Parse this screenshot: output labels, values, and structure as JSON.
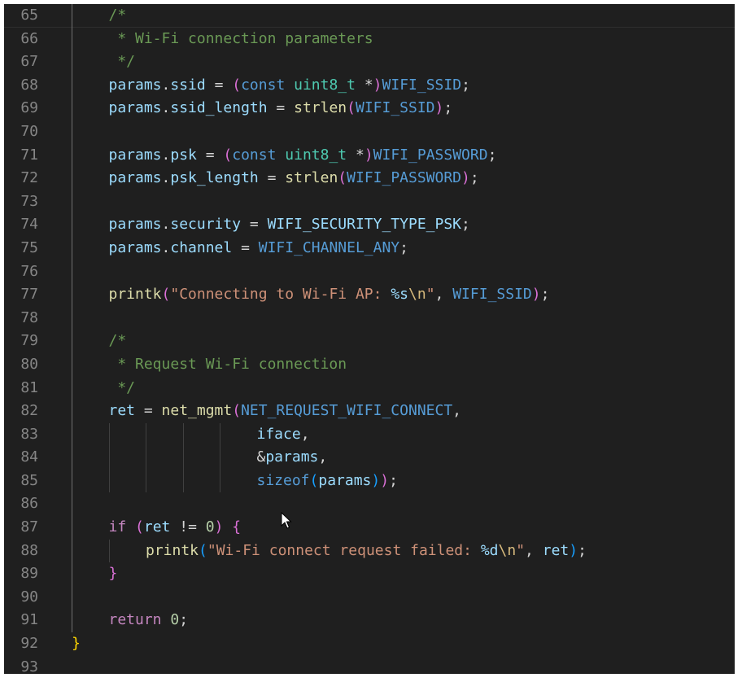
{
  "editor": {
    "lines": [
      {
        "n": "65",
        "indent": 1,
        "tokens": [
          {
            "t": "/*",
            "c": "cmt"
          }
        ]
      },
      {
        "n": "66",
        "indent": 1,
        "tokens": [
          {
            "t": " * Wi-Fi connection parameters",
            "c": "cmt"
          }
        ]
      },
      {
        "n": "67",
        "indent": 1,
        "tokens": [
          {
            "t": " */",
            "c": "cmt"
          }
        ]
      },
      {
        "n": "68",
        "indent": 1,
        "tokens": [
          {
            "t": "params",
            "c": "var"
          },
          {
            "t": ".",
            "c": "pun"
          },
          {
            "t": "ssid",
            "c": "var"
          },
          {
            "t": " = ",
            "c": "pun"
          },
          {
            "t": "(",
            "c": "br2"
          },
          {
            "t": "const",
            "c": "kw"
          },
          {
            "t": " ",
            "c": "pun"
          },
          {
            "t": "uint8_t",
            "c": "typ"
          },
          {
            "t": " *",
            "c": "pun"
          },
          {
            "t": ")",
            "c": "br2"
          },
          {
            "t": "WIFI_SSID",
            "c": "mac"
          },
          {
            "t": ";",
            "c": "pun"
          }
        ]
      },
      {
        "n": "69",
        "indent": 1,
        "tokens": [
          {
            "t": "params",
            "c": "var"
          },
          {
            "t": ".",
            "c": "pun"
          },
          {
            "t": "ssid_length",
            "c": "var"
          },
          {
            "t": " = ",
            "c": "pun"
          },
          {
            "t": "strlen",
            "c": "fn"
          },
          {
            "t": "(",
            "c": "br2"
          },
          {
            "t": "WIFI_SSID",
            "c": "mac"
          },
          {
            "t": ")",
            "c": "br2"
          },
          {
            "t": ";",
            "c": "pun"
          }
        ]
      },
      {
        "n": "70",
        "indent": 1,
        "tokens": []
      },
      {
        "n": "71",
        "indent": 1,
        "tokens": [
          {
            "t": "params",
            "c": "var"
          },
          {
            "t": ".",
            "c": "pun"
          },
          {
            "t": "psk",
            "c": "var"
          },
          {
            "t": " = ",
            "c": "pun"
          },
          {
            "t": "(",
            "c": "br2"
          },
          {
            "t": "const",
            "c": "kw"
          },
          {
            "t": " ",
            "c": "pun"
          },
          {
            "t": "uint8_t",
            "c": "typ"
          },
          {
            "t": " *",
            "c": "pun"
          },
          {
            "t": ")",
            "c": "br2"
          },
          {
            "t": "WIFI_PASSWORD",
            "c": "mac"
          },
          {
            "t": ";",
            "c": "pun"
          }
        ]
      },
      {
        "n": "72",
        "indent": 1,
        "tokens": [
          {
            "t": "params",
            "c": "var"
          },
          {
            "t": ".",
            "c": "pun"
          },
          {
            "t": "psk_length",
            "c": "var"
          },
          {
            "t": " = ",
            "c": "pun"
          },
          {
            "t": "strlen",
            "c": "fn"
          },
          {
            "t": "(",
            "c": "br2"
          },
          {
            "t": "WIFI_PASSWORD",
            "c": "mac"
          },
          {
            "t": ")",
            "c": "br2"
          },
          {
            "t": ";",
            "c": "pun"
          }
        ]
      },
      {
        "n": "73",
        "indent": 1,
        "tokens": []
      },
      {
        "n": "74",
        "indent": 1,
        "tokens": [
          {
            "t": "params",
            "c": "var"
          },
          {
            "t": ".",
            "c": "pun"
          },
          {
            "t": "security",
            "c": "var"
          },
          {
            "t": " = ",
            "c": "pun"
          },
          {
            "t": "WIFI_SECURITY_TYPE_PSK",
            "c": "var"
          },
          {
            "t": ";",
            "c": "pun"
          }
        ]
      },
      {
        "n": "75",
        "indent": 1,
        "tokens": [
          {
            "t": "params",
            "c": "var"
          },
          {
            "t": ".",
            "c": "pun"
          },
          {
            "t": "channel",
            "c": "var"
          },
          {
            "t": " = ",
            "c": "pun"
          },
          {
            "t": "WIFI_CHANNEL_ANY",
            "c": "mac"
          },
          {
            "t": ";",
            "c": "pun"
          }
        ]
      },
      {
        "n": "76",
        "indent": 1,
        "tokens": []
      },
      {
        "n": "77",
        "indent": 1,
        "tokens": [
          {
            "t": "printk",
            "c": "fn"
          },
          {
            "t": "(",
            "c": "br2"
          },
          {
            "t": "\"Connecting to Wi-Fi AP: ",
            "c": "str"
          },
          {
            "t": "%s",
            "c": "fmt"
          },
          {
            "t": "\\n",
            "c": "esc"
          },
          {
            "t": "\"",
            "c": "str"
          },
          {
            "t": ", ",
            "c": "pun"
          },
          {
            "t": "WIFI_SSID",
            "c": "mac"
          },
          {
            "t": ")",
            "c": "br2"
          },
          {
            "t": ";",
            "c": "pun"
          }
        ]
      },
      {
        "n": "78",
        "indent": 1,
        "tokens": []
      },
      {
        "n": "79",
        "indent": 1,
        "tokens": [
          {
            "t": "/*",
            "c": "cmt"
          }
        ]
      },
      {
        "n": "80",
        "indent": 1,
        "tokens": [
          {
            "t": " * Request Wi-Fi connection",
            "c": "cmt"
          }
        ]
      },
      {
        "n": "81",
        "indent": 1,
        "tokens": [
          {
            "t": " */",
            "c": "cmt"
          }
        ]
      },
      {
        "n": "82",
        "indent": 1,
        "tokens": [
          {
            "t": "ret",
            "c": "var"
          },
          {
            "t": " = ",
            "c": "pun"
          },
          {
            "t": "net_mgmt",
            "c": "fn"
          },
          {
            "t": "(",
            "c": "br2"
          },
          {
            "t": "NET_REQUEST_WIFI_CONNECT",
            "c": "mac"
          },
          {
            "t": ",",
            "c": "pun"
          }
        ]
      },
      {
        "n": "83",
        "indent": 5,
        "tokens": [
          {
            "t": "iface",
            "c": "var"
          },
          {
            "t": ",",
            "c": "pun"
          }
        ]
      },
      {
        "n": "84",
        "indent": 5,
        "tokens": [
          {
            "t": "&",
            "c": "pun"
          },
          {
            "t": "params",
            "c": "var"
          },
          {
            "t": ",",
            "c": "pun"
          }
        ]
      },
      {
        "n": "85",
        "indent": 5,
        "tokens": [
          {
            "t": "sizeof",
            "c": "kw"
          },
          {
            "t": "(",
            "c": "br3"
          },
          {
            "t": "params",
            "c": "var"
          },
          {
            "t": ")",
            "c": "br3"
          },
          {
            "t": ")",
            "c": "br2"
          },
          {
            "t": ";",
            "c": "pun"
          }
        ]
      },
      {
        "n": "86",
        "indent": 1,
        "tokens": []
      },
      {
        "n": "87",
        "indent": 1,
        "tokens": [
          {
            "t": "if",
            "c": "ctl"
          },
          {
            "t": " ",
            "c": "pun"
          },
          {
            "t": "(",
            "c": "br2"
          },
          {
            "t": "ret",
            "c": "var"
          },
          {
            "t": " != ",
            "c": "pun"
          },
          {
            "t": "0",
            "c": "num"
          },
          {
            "t": ")",
            "c": "br2"
          },
          {
            "t": " ",
            "c": "pun"
          },
          {
            "t": "{",
            "c": "br2"
          }
        ]
      },
      {
        "n": "88",
        "indent": 2,
        "tokens": [
          {
            "t": "printk",
            "c": "fn"
          },
          {
            "t": "(",
            "c": "br3"
          },
          {
            "t": "\"Wi-Fi connect request failed: ",
            "c": "str"
          },
          {
            "t": "%d",
            "c": "fmt"
          },
          {
            "t": "\\n",
            "c": "esc"
          },
          {
            "t": "\"",
            "c": "str"
          },
          {
            "t": ", ",
            "c": "pun"
          },
          {
            "t": "ret",
            "c": "var"
          },
          {
            "t": ")",
            "c": "br3"
          },
          {
            "t": ";",
            "c": "pun"
          }
        ]
      },
      {
        "n": "89",
        "indent": 1,
        "tokens": [
          {
            "t": "}",
            "c": "br2"
          }
        ]
      },
      {
        "n": "90",
        "indent": 1,
        "tokens": []
      },
      {
        "n": "91",
        "indent": 1,
        "tokens": [
          {
            "t": "return",
            "c": "ctl"
          },
          {
            "t": " ",
            "c": "pun"
          },
          {
            "t": "0",
            "c": "num"
          },
          {
            "t": ";",
            "c": "pun"
          }
        ]
      },
      {
        "n": "92",
        "indent": 0,
        "tokens": [
          {
            "t": "}",
            "c": "br1"
          }
        ]
      },
      {
        "n": "93",
        "indent": 0,
        "tokens": []
      }
    ]
  }
}
